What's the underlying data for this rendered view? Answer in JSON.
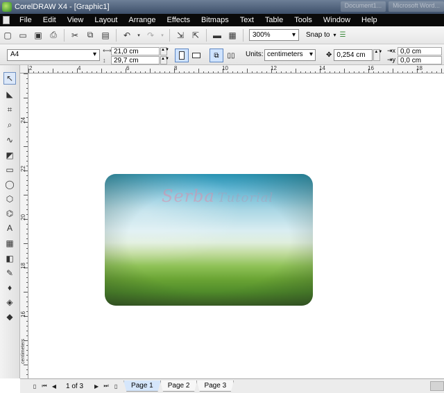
{
  "window": {
    "title": "CorelDRAW X4 - [Graphic1]",
    "background_buttons": [
      "Document1...",
      "Microsoft Word..."
    ]
  },
  "menu": [
    "File",
    "Edit",
    "View",
    "Layout",
    "Arrange",
    "Effects",
    "Bitmaps",
    "Text",
    "Table",
    "Tools",
    "Window",
    "Help"
  ],
  "toolbar": {
    "zoom_value": "300%",
    "snap_label": "Snap to"
  },
  "propertybar": {
    "page_size": "A4",
    "width": "21,0 cm",
    "height": "29,7 cm",
    "units_label": "Units:",
    "units_value": "centimeters",
    "nudge": "0,254 cm",
    "dup_x": "0,0 cm",
    "dup_y": "0,0 cm"
  },
  "ruler": {
    "h_ticks": [
      "2",
      "4",
      "6",
      "8",
      "10",
      "12",
      "14",
      "16",
      "18"
    ],
    "v_ticks": [
      "24",
      "22",
      "20",
      "18",
      "16"
    ],
    "units": "centimeters"
  },
  "card": {
    "watermark_part1": "Serba",
    "watermark_part2": "Tutorial",
    "colors": {
      "sky": "#2aa0c7",
      "mist": "#d9edf1",
      "grass": "#6aa434",
      "dark": "#3b5f24"
    }
  },
  "pagenav": {
    "counter": "1 of 3",
    "tabs": [
      "Page 1",
      "Page 2",
      "Page 3"
    ],
    "active_tab": "Page 1"
  },
  "toolbox": {
    "tools": [
      "pick-tool",
      "shape-tool",
      "crop-tool",
      "zoom-tool",
      "freehand-tool",
      "smart-fill-tool",
      "rectangle-tool",
      "ellipse-tool",
      "polygon-tool",
      "basic-shapes-tool",
      "text-tool",
      "table-tool",
      "interactive-blend-tool",
      "eyedropper-tool",
      "outline-tool",
      "fill-tool",
      "interactive-fill-tool"
    ]
  }
}
